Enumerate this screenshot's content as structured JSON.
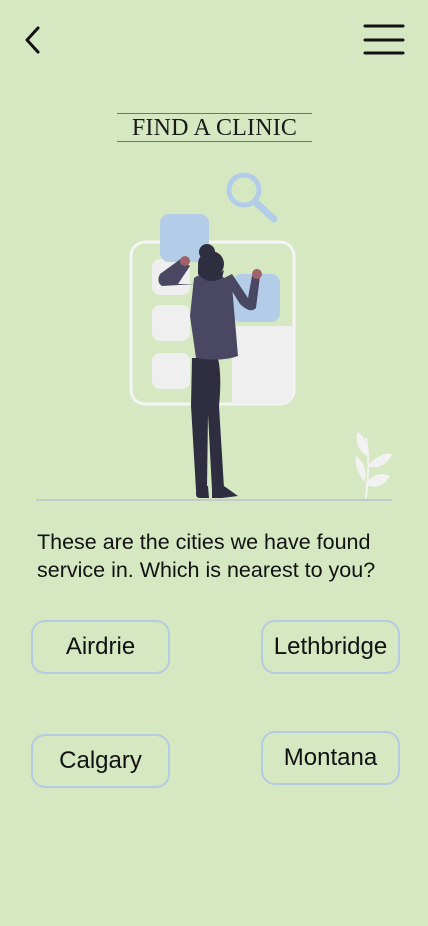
{
  "header": {
    "back_icon": "chevron-left-icon",
    "menu_icon": "hamburger-menu-icon",
    "title": "FIND A CLINIC"
  },
  "illustration": {
    "description_icon": "woman-searching-illustration",
    "colors": {
      "accent_blue": "#b3cde8",
      "card_outline": "#f4f4f4",
      "figure_dark": "#2f2e41",
      "skin": "#a0616a"
    }
  },
  "prompt": "These are the cities we have found service in. Which is nearest to you?",
  "cities": [
    {
      "label": "Airdrie"
    },
    {
      "label": "Lethbridge"
    },
    {
      "label": "Calgary"
    },
    {
      "label": "Montana"
    }
  ],
  "colors": {
    "background": "#d6e8c1",
    "button_border": "#b5cae3"
  }
}
